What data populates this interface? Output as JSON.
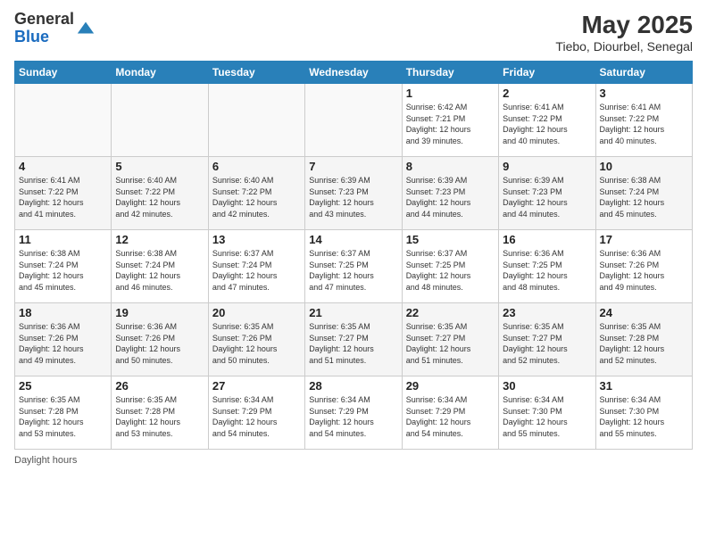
{
  "header": {
    "logo_general": "General",
    "logo_blue": "Blue",
    "month_year": "May 2025",
    "location": "Tiebo, Diourbel, Senegal"
  },
  "calendar": {
    "days_of_week": [
      "Sunday",
      "Monday",
      "Tuesday",
      "Wednesday",
      "Thursday",
      "Friday",
      "Saturday"
    ],
    "weeks": [
      [
        {
          "day": "",
          "info": ""
        },
        {
          "day": "",
          "info": ""
        },
        {
          "day": "",
          "info": ""
        },
        {
          "day": "",
          "info": ""
        },
        {
          "day": "1",
          "info": "Sunrise: 6:42 AM\nSunset: 7:21 PM\nDaylight: 12 hours\nand 39 minutes."
        },
        {
          "day": "2",
          "info": "Sunrise: 6:41 AM\nSunset: 7:22 PM\nDaylight: 12 hours\nand 40 minutes."
        },
        {
          "day": "3",
          "info": "Sunrise: 6:41 AM\nSunset: 7:22 PM\nDaylight: 12 hours\nand 40 minutes."
        }
      ],
      [
        {
          "day": "4",
          "info": "Sunrise: 6:41 AM\nSunset: 7:22 PM\nDaylight: 12 hours\nand 41 minutes."
        },
        {
          "day": "5",
          "info": "Sunrise: 6:40 AM\nSunset: 7:22 PM\nDaylight: 12 hours\nand 42 minutes."
        },
        {
          "day": "6",
          "info": "Sunrise: 6:40 AM\nSunset: 7:22 PM\nDaylight: 12 hours\nand 42 minutes."
        },
        {
          "day": "7",
          "info": "Sunrise: 6:39 AM\nSunset: 7:23 PM\nDaylight: 12 hours\nand 43 minutes."
        },
        {
          "day": "8",
          "info": "Sunrise: 6:39 AM\nSunset: 7:23 PM\nDaylight: 12 hours\nand 44 minutes."
        },
        {
          "day": "9",
          "info": "Sunrise: 6:39 AM\nSunset: 7:23 PM\nDaylight: 12 hours\nand 44 minutes."
        },
        {
          "day": "10",
          "info": "Sunrise: 6:38 AM\nSunset: 7:24 PM\nDaylight: 12 hours\nand 45 minutes."
        }
      ],
      [
        {
          "day": "11",
          "info": "Sunrise: 6:38 AM\nSunset: 7:24 PM\nDaylight: 12 hours\nand 45 minutes."
        },
        {
          "day": "12",
          "info": "Sunrise: 6:38 AM\nSunset: 7:24 PM\nDaylight: 12 hours\nand 46 minutes."
        },
        {
          "day": "13",
          "info": "Sunrise: 6:37 AM\nSunset: 7:24 PM\nDaylight: 12 hours\nand 47 minutes."
        },
        {
          "day": "14",
          "info": "Sunrise: 6:37 AM\nSunset: 7:25 PM\nDaylight: 12 hours\nand 47 minutes."
        },
        {
          "day": "15",
          "info": "Sunrise: 6:37 AM\nSunset: 7:25 PM\nDaylight: 12 hours\nand 48 minutes."
        },
        {
          "day": "16",
          "info": "Sunrise: 6:36 AM\nSunset: 7:25 PM\nDaylight: 12 hours\nand 48 minutes."
        },
        {
          "day": "17",
          "info": "Sunrise: 6:36 AM\nSunset: 7:26 PM\nDaylight: 12 hours\nand 49 minutes."
        }
      ],
      [
        {
          "day": "18",
          "info": "Sunrise: 6:36 AM\nSunset: 7:26 PM\nDaylight: 12 hours\nand 49 minutes."
        },
        {
          "day": "19",
          "info": "Sunrise: 6:36 AM\nSunset: 7:26 PM\nDaylight: 12 hours\nand 50 minutes."
        },
        {
          "day": "20",
          "info": "Sunrise: 6:35 AM\nSunset: 7:26 PM\nDaylight: 12 hours\nand 50 minutes."
        },
        {
          "day": "21",
          "info": "Sunrise: 6:35 AM\nSunset: 7:27 PM\nDaylight: 12 hours\nand 51 minutes."
        },
        {
          "day": "22",
          "info": "Sunrise: 6:35 AM\nSunset: 7:27 PM\nDaylight: 12 hours\nand 51 minutes."
        },
        {
          "day": "23",
          "info": "Sunrise: 6:35 AM\nSunset: 7:27 PM\nDaylight: 12 hours\nand 52 minutes."
        },
        {
          "day": "24",
          "info": "Sunrise: 6:35 AM\nSunset: 7:28 PM\nDaylight: 12 hours\nand 52 minutes."
        }
      ],
      [
        {
          "day": "25",
          "info": "Sunrise: 6:35 AM\nSunset: 7:28 PM\nDaylight: 12 hours\nand 53 minutes."
        },
        {
          "day": "26",
          "info": "Sunrise: 6:35 AM\nSunset: 7:28 PM\nDaylight: 12 hours\nand 53 minutes."
        },
        {
          "day": "27",
          "info": "Sunrise: 6:34 AM\nSunset: 7:29 PM\nDaylight: 12 hours\nand 54 minutes."
        },
        {
          "day": "28",
          "info": "Sunrise: 6:34 AM\nSunset: 7:29 PM\nDaylight: 12 hours\nand 54 minutes."
        },
        {
          "day": "29",
          "info": "Sunrise: 6:34 AM\nSunset: 7:29 PM\nDaylight: 12 hours\nand 54 minutes."
        },
        {
          "day": "30",
          "info": "Sunrise: 6:34 AM\nSunset: 7:30 PM\nDaylight: 12 hours\nand 55 minutes."
        },
        {
          "day": "31",
          "info": "Sunrise: 6:34 AM\nSunset: 7:30 PM\nDaylight: 12 hours\nand 55 minutes."
        }
      ]
    ]
  },
  "footer": {
    "daylight_hours": "Daylight hours"
  }
}
